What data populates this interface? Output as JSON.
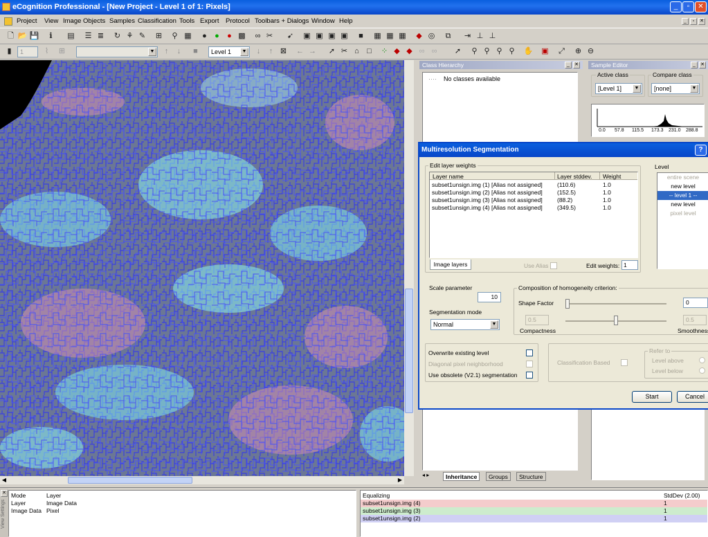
{
  "window": {
    "title": "eCognition Professional - [New Project - Level 1 of 1: Pixels]"
  },
  "menu": [
    "Project",
    "View",
    "Image Objects",
    "Samples",
    "Classification",
    "Tools",
    "Export",
    "Protocol",
    "Toolbars + Dialogs",
    "Window",
    "Help"
  ],
  "toolbar2": {
    "level_select": "Level 1",
    "field1": "1"
  },
  "class_hierarchy": {
    "title": "Class Hierarchy",
    "empty_text": "No classes available",
    "tabs": [
      "Inheritance",
      "Groups",
      "Structure"
    ]
  },
  "sample_editor": {
    "title": "Sample Editor",
    "active_label": "Active class",
    "active_value": "[Level 1]",
    "compare_label": "Compare class",
    "compare_value": "[none]",
    "axis": [
      "0.0",
      "57.8",
      "115.5",
      "173.3",
      "231.0",
      "288.8"
    ]
  },
  "dialog": {
    "title": "Multiresolution Segmentation",
    "layer_weights_label": "Edit layer weights",
    "headers": [
      "Layer name",
      "Layer stddev.",
      "Weight"
    ],
    "rows": [
      {
        "name": "subset1unsign.img (1) [Alias not assigned]",
        "std": "(110.6)",
        "w": "1.0"
      },
      {
        "name": "subset1unsign.img (2) [Alias not assigned]",
        "std": "(152.5)",
        "w": "1.0"
      },
      {
        "name": "subset1unsign.img (3) [Alias not assigned]",
        "std": "(88.2)",
        "w": "1.0"
      },
      {
        "name": "subset1unsign.img (4) [Alias not assigned]",
        "std": "(349.5)",
        "w": "1.0"
      }
    ],
    "image_layers_tab": "Image layers",
    "use_alias": "Use Alias",
    "edit_weights_label": "Edit weights:",
    "edit_weights_value": "1",
    "level_label": "Level",
    "levels": [
      "entire scene",
      "new level",
      "-- level 1 --",
      "new level",
      "pixel level"
    ],
    "scale_label": "Scale parameter",
    "scale_value": "10",
    "mode_label": "Segmentation mode",
    "mode_value": "Normal",
    "homog_label": "Composition of homogeneity criterion:",
    "shape_label": "Shape Factor",
    "shape_value": "0",
    "compact_value": "0.5",
    "compact_label": "Compactness",
    "smooth_value": "0.5",
    "smooth_label": "Smoothness",
    "opt_overwrite": "Overwrite existing level",
    "opt_diagonal": "Diagonal pixel neighborhood",
    "opt_obsolete": "Use obsolete (V2.1) segmentation",
    "class_based": "Classification Based",
    "refer_to": "Refer to",
    "level_above": "Level above",
    "level_below": "Level below",
    "start": "Start",
    "cancel": "Cancel"
  },
  "info_panel": {
    "rows": [
      [
        "Mode",
        "Layer"
      ],
      [
        "Layer",
        "Image Data"
      ],
      [
        "Image Data",
        "Pixel"
      ]
    ],
    "side_label": "View Settings"
  },
  "equalize_panel": {
    "header_left": "Equalizing",
    "header_right": "StdDev (2.00)",
    "rows": [
      {
        "name": "subset1unsign.img (4)",
        "value": "1",
        "color": "#f4cccc"
      },
      {
        "name": "subset1unsign.img (3)",
        "value": "1",
        "color": "#cdeccd"
      },
      {
        "name": "subset1unsign.img (2)",
        "value": "1",
        "color": "#d0d0f4"
      }
    ]
  }
}
